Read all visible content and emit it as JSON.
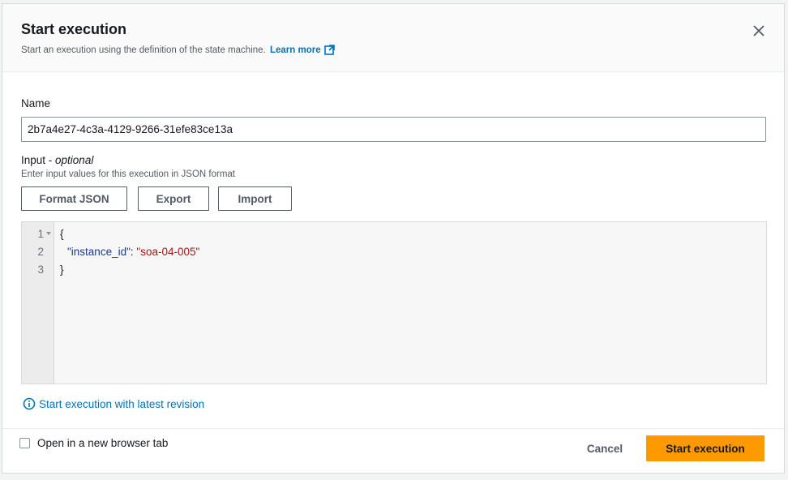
{
  "modal": {
    "title": "Start execution",
    "subtitle": "Start an execution using the definition of the state machine.",
    "learn_more": "Learn more",
    "close_icon": "close-icon",
    "external_icon": "external-link-icon"
  },
  "name_field": {
    "label": "Name",
    "value": "2b7a4e27-4c3a-4129-9266-31efe83ce13a"
  },
  "input_field": {
    "label": "Input - ",
    "label_optional": "optional",
    "hint": "Enter input values for this execution in JSON format",
    "buttons": {
      "format": "Format JSON",
      "export": "Export",
      "import": "Import"
    }
  },
  "editor": {
    "line_numbers": [
      "1",
      "2",
      "3"
    ],
    "lines": {
      "open": "{",
      "key": "\"instance_id\"",
      "colon": ": ",
      "value": "\"soa-04-005\"",
      "close": "}"
    }
  },
  "revision_link": {
    "icon": "info-icon",
    "label": "Start execution with latest revision"
  },
  "footer": {
    "checkbox_label": "Open in a new browser tab",
    "checkbox_checked": false,
    "cancel": "Cancel",
    "submit": "Start execution"
  },
  "colors": {
    "accent": "#ff9900",
    "link": "#0073bb",
    "json_key": "#1a3b8f",
    "json_string": "#a31515"
  }
}
